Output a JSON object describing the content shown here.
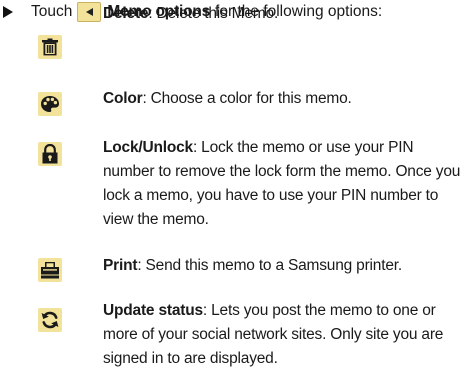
{
  "intro": {
    "prefix": "Touch",
    "button_label": "Memo options",
    "suffix": "for the following options:"
  },
  "options": [
    {
      "icon": "trash-icon",
      "title": "Delete",
      "desc": ": Delete this Memo."
    },
    {
      "icon": "palette-icon",
      "title": "Color",
      "desc": ": Choose a color for this memo."
    },
    {
      "icon": "lock-icon",
      "title": "Lock/Unlock",
      "desc": ": Lock the memo or use your PIN number to remove the lock form the memo. Once you lock a memo, you have to use your PIN number to view the memo."
    },
    {
      "icon": "printer-icon",
      "title": "Print",
      "desc": ": Send this memo to a Samsung printer."
    },
    {
      "icon": "refresh-icon",
      "title": "Update status",
      "desc": ": Lets you post the memo to one or more of your social network sites. Only site you are signed in to are displayed."
    }
  ],
  "colors": {
    "icon_bg": "#f3e29a",
    "icon_fg": "#1a1a1a",
    "text": "#1a1a1a"
  }
}
